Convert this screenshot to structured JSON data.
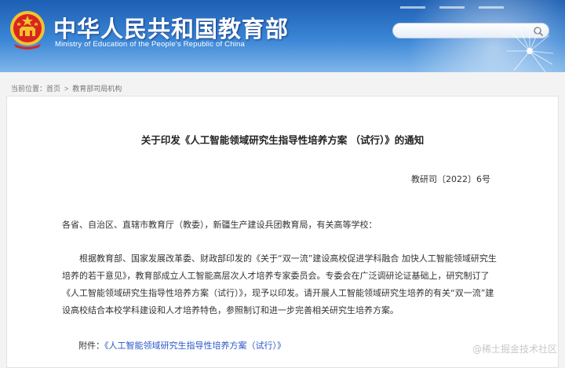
{
  "header": {
    "title_cn": "中华人民共和国教育部",
    "title_en": "Ministry of Education of the People's Republic of China",
    "emblem_icon": "national-emblem-icon",
    "search": {
      "placeholder": "",
      "icon": "search-icon"
    }
  },
  "breadcrumb": {
    "prefix": "当前位置：",
    "home": "首页",
    "sep": ">",
    "current": "教育部司局机构"
  },
  "document": {
    "title": "关于印发《人工智能领域研究生指导性培养方案 （试行）》的通知",
    "number": "教研司〔2022〕6号",
    "addressees": "各省、自治区、直辖市教育厅（教委），新疆生产建设兵团教育局，有关高等学校：",
    "body": "根据教育部、国家发展改革委、财政部印发的《关于“双一流”建设高校促进学科融合 加快人工智能领域研究生培养的若干意见》，教育部成立人工智能高层次人才培养专家委员会。专委会在广泛调研论证基础上，研究制订了《人工智能领域研究生指导性培养方案（试行）》，现予以印发。请开展人工智能领域研究生培养的有关“双一流”建设高校结合本校学科建设和人才培养特色，参照制订和进一步完善相关研究生培养方案。",
    "attachment_label": "附件：",
    "attachment_link": "《人工智能领域研究生指导性培养方案（试行）》"
  },
  "watermark": "@稀土掘金技术社区",
  "colors": {
    "header_top": "#1d5fb3",
    "header_bottom": "#7fb6ea",
    "link": "#2a57c8"
  }
}
